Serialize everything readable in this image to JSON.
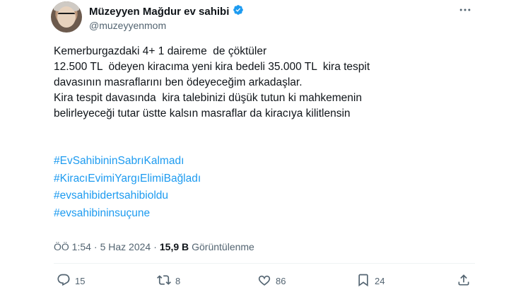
{
  "author": {
    "name": "Müzeyyen Mağdur ev sahibi",
    "handle": "@muzeyyenmom"
  },
  "more_icon": "more-horizontal-icon",
  "tweet": {
    "text": "Kemerburgazdaki 4+ 1 daireme  de çöktüler\n12.500 TL  ödeyen kiracıma yeni kira bedeli 35.000 TL  kira tespit\ndavasının masraflarını ben ödeyeceğim arkadaşlar.\nKira tespit davasında  kira talebinizi düşük tutun ki mahkemenin\nbelirleyeceği tutar üstte kalsın masraflar da kiracıya kilitlensin",
    "hashtags": [
      "#EvSahibininSabrıKalmadı",
      "#KiracıEvimiYargıElimiBağladı",
      "#evsahibidertsahibioldu",
      "#evsahibininsuçune"
    ]
  },
  "meta": {
    "time": "ÖÖ 1:54",
    "separator1": "·",
    "date": "5 Haz 2024",
    "separator2": "·",
    "views_count": "15,9 B",
    "views_label": "Görüntülenme"
  },
  "actions": {
    "reply_count": "15",
    "retweet_count": "8",
    "like_count": "86",
    "bookmark_count": "24"
  },
  "colors": {
    "accent": "#1d9bf0",
    "text": "#0f1419",
    "secondary": "#536471"
  }
}
